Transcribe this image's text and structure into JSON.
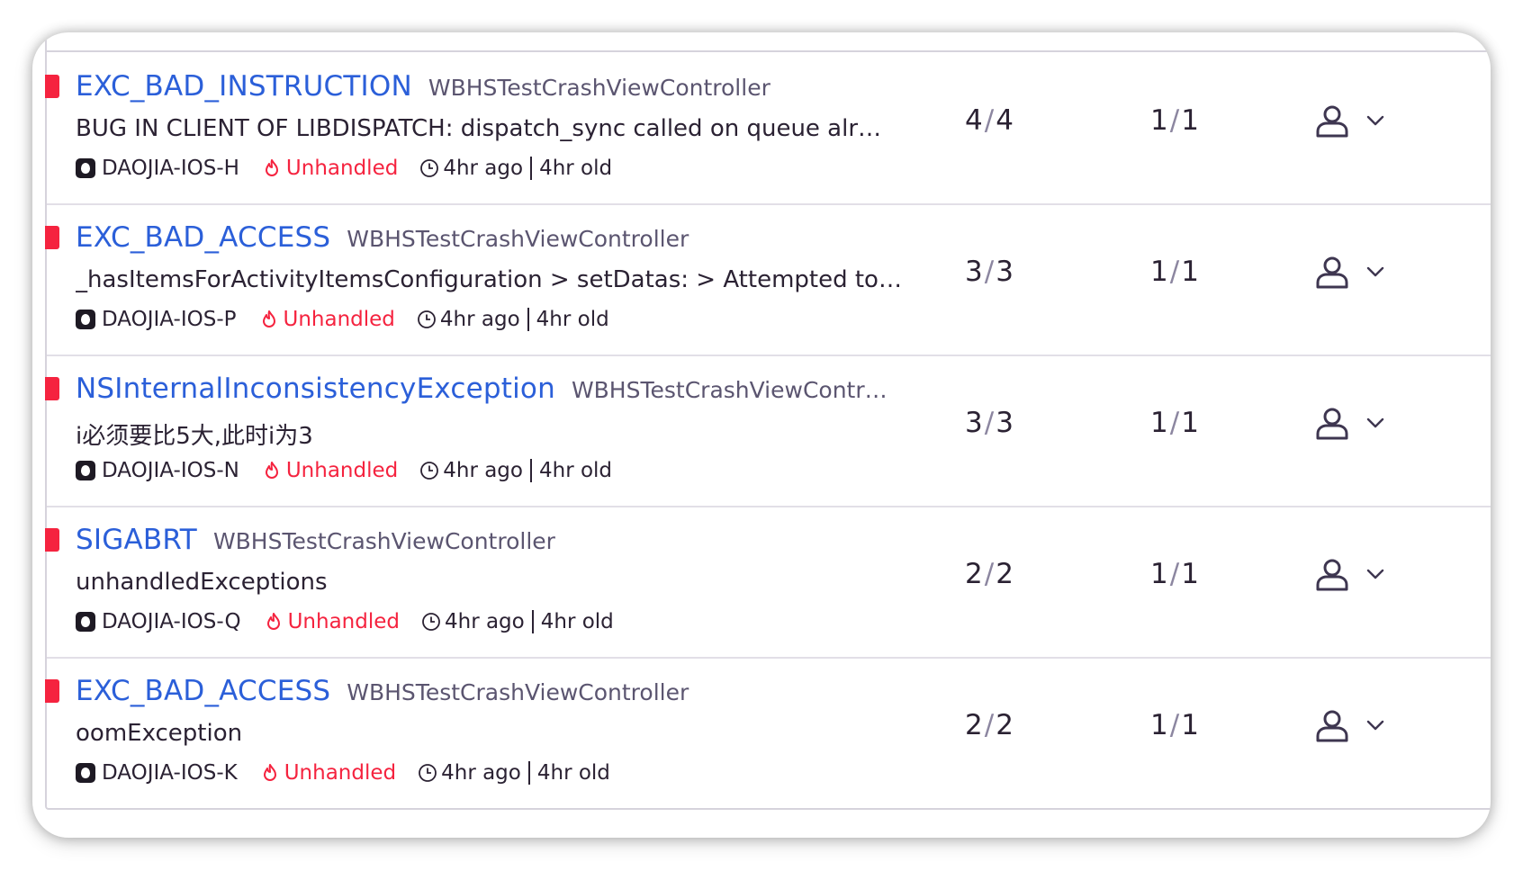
{
  "issues": [
    {
      "type": "EXC_BAD_INSTRUCTION",
      "culprit": "WBHSTestCrashViewController",
      "message": "BUG IN CLIENT OF LIBDISPATCH: dispatch_sync called on queue alr…",
      "short_id": "DAOJIA-IOS-H",
      "mechanism": "Unhandled",
      "last_seen": "4hr ago",
      "age": "4hr old",
      "events": "4",
      "events_total": "4",
      "users": "1",
      "users_total": "1"
    },
    {
      "type": "EXC_BAD_ACCESS",
      "culprit": "WBHSTestCrashViewController",
      "message": "_hasItemsForActivityItemsConfiguration > setDatas: > Attempted to…",
      "short_id": "DAOJIA-IOS-P",
      "mechanism": "Unhandled",
      "last_seen": "4hr ago",
      "age": "4hr old",
      "events": "3",
      "events_total": "3",
      "users": "1",
      "users_total": "1"
    },
    {
      "type": "NSInternalInconsistencyException",
      "culprit": "WBHSTestCrashViewContr…",
      "message": "i必须要比5大,此时i为3",
      "short_id": "DAOJIA-IOS-N",
      "mechanism": "Unhandled",
      "last_seen": "4hr ago",
      "age": "4hr old",
      "events": "3",
      "events_total": "3",
      "users": "1",
      "users_total": "1"
    },
    {
      "type": "SIGABRT",
      "culprit": "WBHSTestCrashViewController",
      "message": "unhandledExceptions",
      "short_id": "DAOJIA-IOS-Q",
      "mechanism": "Unhandled",
      "last_seen": "4hr ago",
      "age": "4hr old",
      "events": "2",
      "events_total": "2",
      "users": "1",
      "users_total": "1"
    },
    {
      "type": "EXC_BAD_ACCESS",
      "culprit": "WBHSTestCrashViewController",
      "message": "oomException",
      "short_id": "DAOJIA-IOS-K",
      "mechanism": "Unhandled",
      "last_seen": "4hr ago",
      "age": "4hr old",
      "events": "2",
      "events_total": "2",
      "users": "1",
      "users_total": "1"
    }
  ],
  "colors": {
    "level_error": "#f5233f",
    "link_blue": "#2b5fd9",
    "culprit_gray": "#5b5570",
    "text_dark": "#2b2233",
    "unhandled_red": "#f5233f"
  },
  "icons": {
    "platform": "apple-icon",
    "mechanism": "flame-icon",
    "time": "clock-icon",
    "assignee": "user-icon",
    "menu": "chevron-down-icon"
  }
}
